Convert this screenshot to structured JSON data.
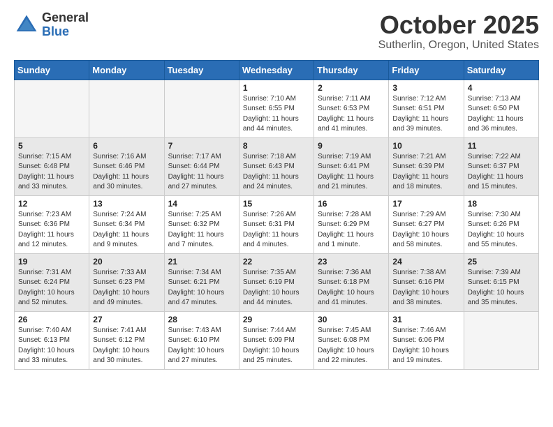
{
  "header": {
    "logo_general": "General",
    "logo_blue": "Blue",
    "month_title": "October 2025",
    "location": "Sutherlin, Oregon, United States"
  },
  "days_of_week": [
    "Sunday",
    "Monday",
    "Tuesday",
    "Wednesday",
    "Thursday",
    "Friday",
    "Saturday"
  ],
  "weeks": [
    [
      {
        "day": "",
        "sunrise": "",
        "sunset": "",
        "daylight": "",
        "empty": true
      },
      {
        "day": "",
        "sunrise": "",
        "sunset": "",
        "daylight": "",
        "empty": true
      },
      {
        "day": "",
        "sunrise": "",
        "sunset": "",
        "daylight": "",
        "empty": true
      },
      {
        "day": "1",
        "sunrise": "Sunrise: 7:10 AM",
        "sunset": "Sunset: 6:55 PM",
        "daylight": "Daylight: 11 hours and 44 minutes."
      },
      {
        "day": "2",
        "sunrise": "Sunrise: 7:11 AM",
        "sunset": "Sunset: 6:53 PM",
        "daylight": "Daylight: 11 hours and 41 minutes."
      },
      {
        "day": "3",
        "sunrise": "Sunrise: 7:12 AM",
        "sunset": "Sunset: 6:51 PM",
        "daylight": "Daylight: 11 hours and 39 minutes."
      },
      {
        "day": "4",
        "sunrise": "Sunrise: 7:13 AM",
        "sunset": "Sunset: 6:50 PM",
        "daylight": "Daylight: 11 hours and 36 minutes."
      }
    ],
    [
      {
        "day": "5",
        "sunrise": "Sunrise: 7:15 AM",
        "sunset": "Sunset: 6:48 PM",
        "daylight": "Daylight: 11 hours and 33 minutes."
      },
      {
        "day": "6",
        "sunrise": "Sunrise: 7:16 AM",
        "sunset": "Sunset: 6:46 PM",
        "daylight": "Daylight: 11 hours and 30 minutes."
      },
      {
        "day": "7",
        "sunrise": "Sunrise: 7:17 AM",
        "sunset": "Sunset: 6:44 PM",
        "daylight": "Daylight: 11 hours and 27 minutes."
      },
      {
        "day": "8",
        "sunrise": "Sunrise: 7:18 AM",
        "sunset": "Sunset: 6:43 PM",
        "daylight": "Daylight: 11 hours and 24 minutes."
      },
      {
        "day": "9",
        "sunrise": "Sunrise: 7:19 AM",
        "sunset": "Sunset: 6:41 PM",
        "daylight": "Daylight: 11 hours and 21 minutes."
      },
      {
        "day": "10",
        "sunrise": "Sunrise: 7:21 AM",
        "sunset": "Sunset: 6:39 PM",
        "daylight": "Daylight: 11 hours and 18 minutes."
      },
      {
        "day": "11",
        "sunrise": "Sunrise: 7:22 AM",
        "sunset": "Sunset: 6:37 PM",
        "daylight": "Daylight: 11 hours and 15 minutes."
      }
    ],
    [
      {
        "day": "12",
        "sunrise": "Sunrise: 7:23 AM",
        "sunset": "Sunset: 6:36 PM",
        "daylight": "Daylight: 11 hours and 12 minutes."
      },
      {
        "day": "13",
        "sunrise": "Sunrise: 7:24 AM",
        "sunset": "Sunset: 6:34 PM",
        "daylight": "Daylight: 11 hours and 9 minutes."
      },
      {
        "day": "14",
        "sunrise": "Sunrise: 7:25 AM",
        "sunset": "Sunset: 6:32 PM",
        "daylight": "Daylight: 11 hours and 7 minutes."
      },
      {
        "day": "15",
        "sunrise": "Sunrise: 7:26 AM",
        "sunset": "Sunset: 6:31 PM",
        "daylight": "Daylight: 11 hours and 4 minutes."
      },
      {
        "day": "16",
        "sunrise": "Sunrise: 7:28 AM",
        "sunset": "Sunset: 6:29 PM",
        "daylight": "Daylight: 11 hours and 1 minute."
      },
      {
        "day": "17",
        "sunrise": "Sunrise: 7:29 AM",
        "sunset": "Sunset: 6:27 PM",
        "daylight": "Daylight: 10 hours and 58 minutes."
      },
      {
        "day": "18",
        "sunrise": "Sunrise: 7:30 AM",
        "sunset": "Sunset: 6:26 PM",
        "daylight": "Daylight: 10 hours and 55 minutes."
      }
    ],
    [
      {
        "day": "19",
        "sunrise": "Sunrise: 7:31 AM",
        "sunset": "Sunset: 6:24 PM",
        "daylight": "Daylight: 10 hours and 52 minutes."
      },
      {
        "day": "20",
        "sunrise": "Sunrise: 7:33 AM",
        "sunset": "Sunset: 6:23 PM",
        "daylight": "Daylight: 10 hours and 49 minutes."
      },
      {
        "day": "21",
        "sunrise": "Sunrise: 7:34 AM",
        "sunset": "Sunset: 6:21 PM",
        "daylight": "Daylight: 10 hours and 47 minutes."
      },
      {
        "day": "22",
        "sunrise": "Sunrise: 7:35 AM",
        "sunset": "Sunset: 6:19 PM",
        "daylight": "Daylight: 10 hours and 44 minutes."
      },
      {
        "day": "23",
        "sunrise": "Sunrise: 7:36 AM",
        "sunset": "Sunset: 6:18 PM",
        "daylight": "Daylight: 10 hours and 41 minutes."
      },
      {
        "day": "24",
        "sunrise": "Sunrise: 7:38 AM",
        "sunset": "Sunset: 6:16 PM",
        "daylight": "Daylight: 10 hours and 38 minutes."
      },
      {
        "day": "25",
        "sunrise": "Sunrise: 7:39 AM",
        "sunset": "Sunset: 6:15 PM",
        "daylight": "Daylight: 10 hours and 35 minutes."
      }
    ],
    [
      {
        "day": "26",
        "sunrise": "Sunrise: 7:40 AM",
        "sunset": "Sunset: 6:13 PM",
        "daylight": "Daylight: 10 hours and 33 minutes."
      },
      {
        "day": "27",
        "sunrise": "Sunrise: 7:41 AM",
        "sunset": "Sunset: 6:12 PM",
        "daylight": "Daylight: 10 hours and 30 minutes."
      },
      {
        "day": "28",
        "sunrise": "Sunrise: 7:43 AM",
        "sunset": "Sunset: 6:10 PM",
        "daylight": "Daylight: 10 hours and 27 minutes."
      },
      {
        "day": "29",
        "sunrise": "Sunrise: 7:44 AM",
        "sunset": "Sunset: 6:09 PM",
        "daylight": "Daylight: 10 hours and 25 minutes."
      },
      {
        "day": "30",
        "sunrise": "Sunrise: 7:45 AM",
        "sunset": "Sunset: 6:08 PM",
        "daylight": "Daylight: 10 hours and 22 minutes."
      },
      {
        "day": "31",
        "sunrise": "Sunrise: 7:46 AM",
        "sunset": "Sunset: 6:06 PM",
        "daylight": "Daylight: 10 hours and 19 minutes."
      },
      {
        "day": "",
        "sunrise": "",
        "sunset": "",
        "daylight": "",
        "empty": true
      }
    ]
  ]
}
